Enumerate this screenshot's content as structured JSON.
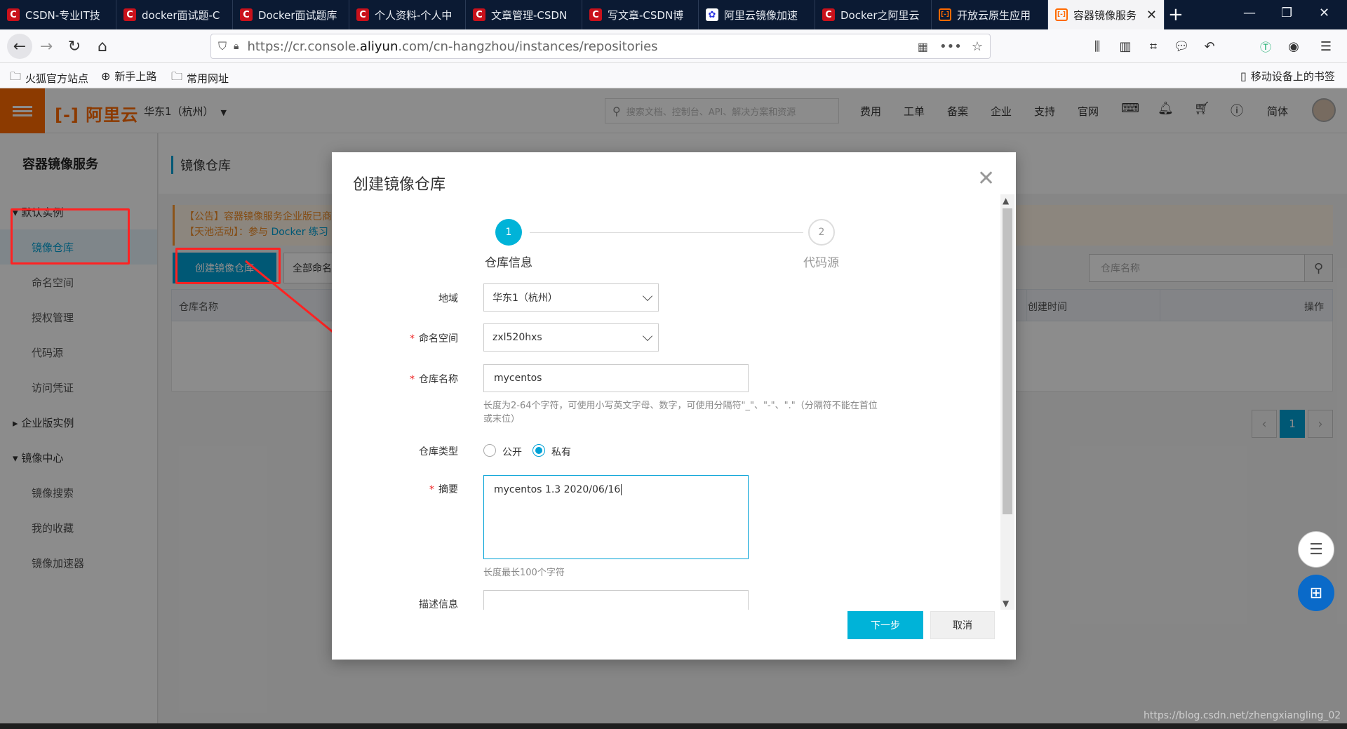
{
  "browser": {
    "tabs": [
      {
        "title": "CSDN-专业IT技",
        "icon": "csdn"
      },
      {
        "title": "docker面试题-C",
        "icon": "csdn"
      },
      {
        "title": "Docker面试题库",
        "icon": "csdn"
      },
      {
        "title": "个人资料-个人中",
        "icon": "csdn"
      },
      {
        "title": "文章管理-CSDN",
        "icon": "csdn"
      },
      {
        "title": "写文章-CSDN博",
        "icon": "csdn"
      },
      {
        "title": "阿里云镜像加速",
        "icon": "baidu"
      },
      {
        "title": "Docker之阿里云",
        "icon": "csdn"
      },
      {
        "title": "开放云原生应用",
        "icon": "aliyun"
      },
      {
        "title": "容器镜像服务",
        "icon": "aliyun"
      }
    ],
    "url_prefix": "https://cr.console.",
    "url_domain": "aliyun",
    "url_suffix": ".com/cn-hangzhou/instances/repositories",
    "bookmarks": [
      "火狐官方站点",
      "新手上路",
      "常用网址"
    ],
    "mobile_bookmarks": "移动设备上的书签"
  },
  "console": {
    "logo": "阿里云",
    "region": "华东1（杭州）",
    "search_placeholder": "搜索文档、控制台、API、解决方案和资源",
    "links": [
      "费用",
      "工单",
      "备案",
      "企业",
      "支持",
      "官网"
    ],
    "lang": "简体"
  },
  "sidebar": {
    "title": "容器镜像服务",
    "group_default": "默认实例",
    "items": [
      "镜像仓库",
      "命名空间",
      "授权管理",
      "代码源",
      "访问凭证"
    ],
    "group_enterprise": "企业版实例",
    "group_hub": "镜像中心",
    "hub_items": [
      "镜像搜索",
      "我的收藏",
      "镜像加速器"
    ]
  },
  "page": {
    "title": "镜像仓库",
    "notice_1": "【公告】容器镜像服务企业版已商",
    "notice_2_prefix": "【天池活动】：参与 ",
    "notice_2_link": "Docker 练习",
    "create_button": "创建镜像仓库",
    "namespace_filter": "全部命名",
    "search_placeholder": "仓库名称",
    "col_name": "仓库名称",
    "col_created": "创建时间",
    "col_ops": "操作",
    "current_page": "1"
  },
  "dialog": {
    "title": "创建镜像仓库",
    "step1_num": "1",
    "step1_label": "仓库信息",
    "step2_num": "2",
    "step2_label": "代码源",
    "region_label": "地域",
    "region_value": "华东1（杭州）",
    "ns_label": "命名空间",
    "ns_value": "zxl520hxs",
    "name_label": "仓库名称",
    "name_value": "mycentos",
    "name_hint_1": "长度为2-64个字符，可使用小写英文字母、数字，可使用分隔符\"_\"、\"-\"、\".\"（分隔符不能在首位",
    "name_hint_2": "或末位）",
    "type_label": "仓库类型",
    "type_public": "公开",
    "type_private": "私有",
    "type_selected": "私有",
    "summary_label": "摘要",
    "summary_value": "mycentos 1.3 2020/06/16",
    "summary_hint": "长度最长100个字符",
    "desc_label": "描述信息",
    "next_button": "下一步",
    "cancel_button": "取消"
  },
  "watermark": "https://blog.csdn.net/zhengxiangling_02",
  "colors": {
    "accent": "#00a1d6",
    "brand": "#ff6a00",
    "annotation": "#ff2222"
  }
}
